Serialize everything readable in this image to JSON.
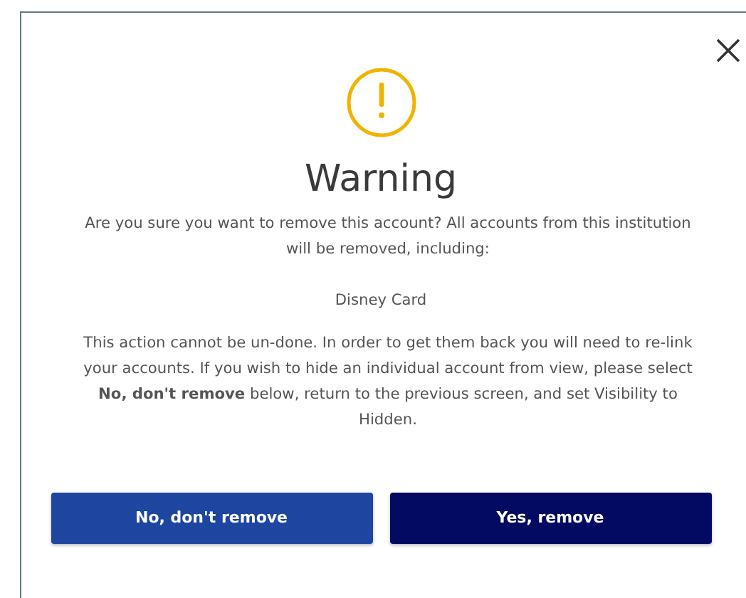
{
  "dialog": {
    "title": "Warning",
    "message": "Are you sure you want to remove this account? All accounts from this institution will be removed, including:",
    "accounts": [
      "Disney Card"
    ],
    "note": "This action cannot be un-done. In order to get them back you will need to re-link your accounts. If you wish to hide an individual account from view, please select **No, don't remove** below, return to the previous screen, and set Visibility to Hidden.",
    "buttons": [
      {
        "label": "No, don't remove",
        "kind": "secondary"
      },
      {
        "label": "Yes, remove",
        "kind": "primary"
      }
    ]
  }
}
